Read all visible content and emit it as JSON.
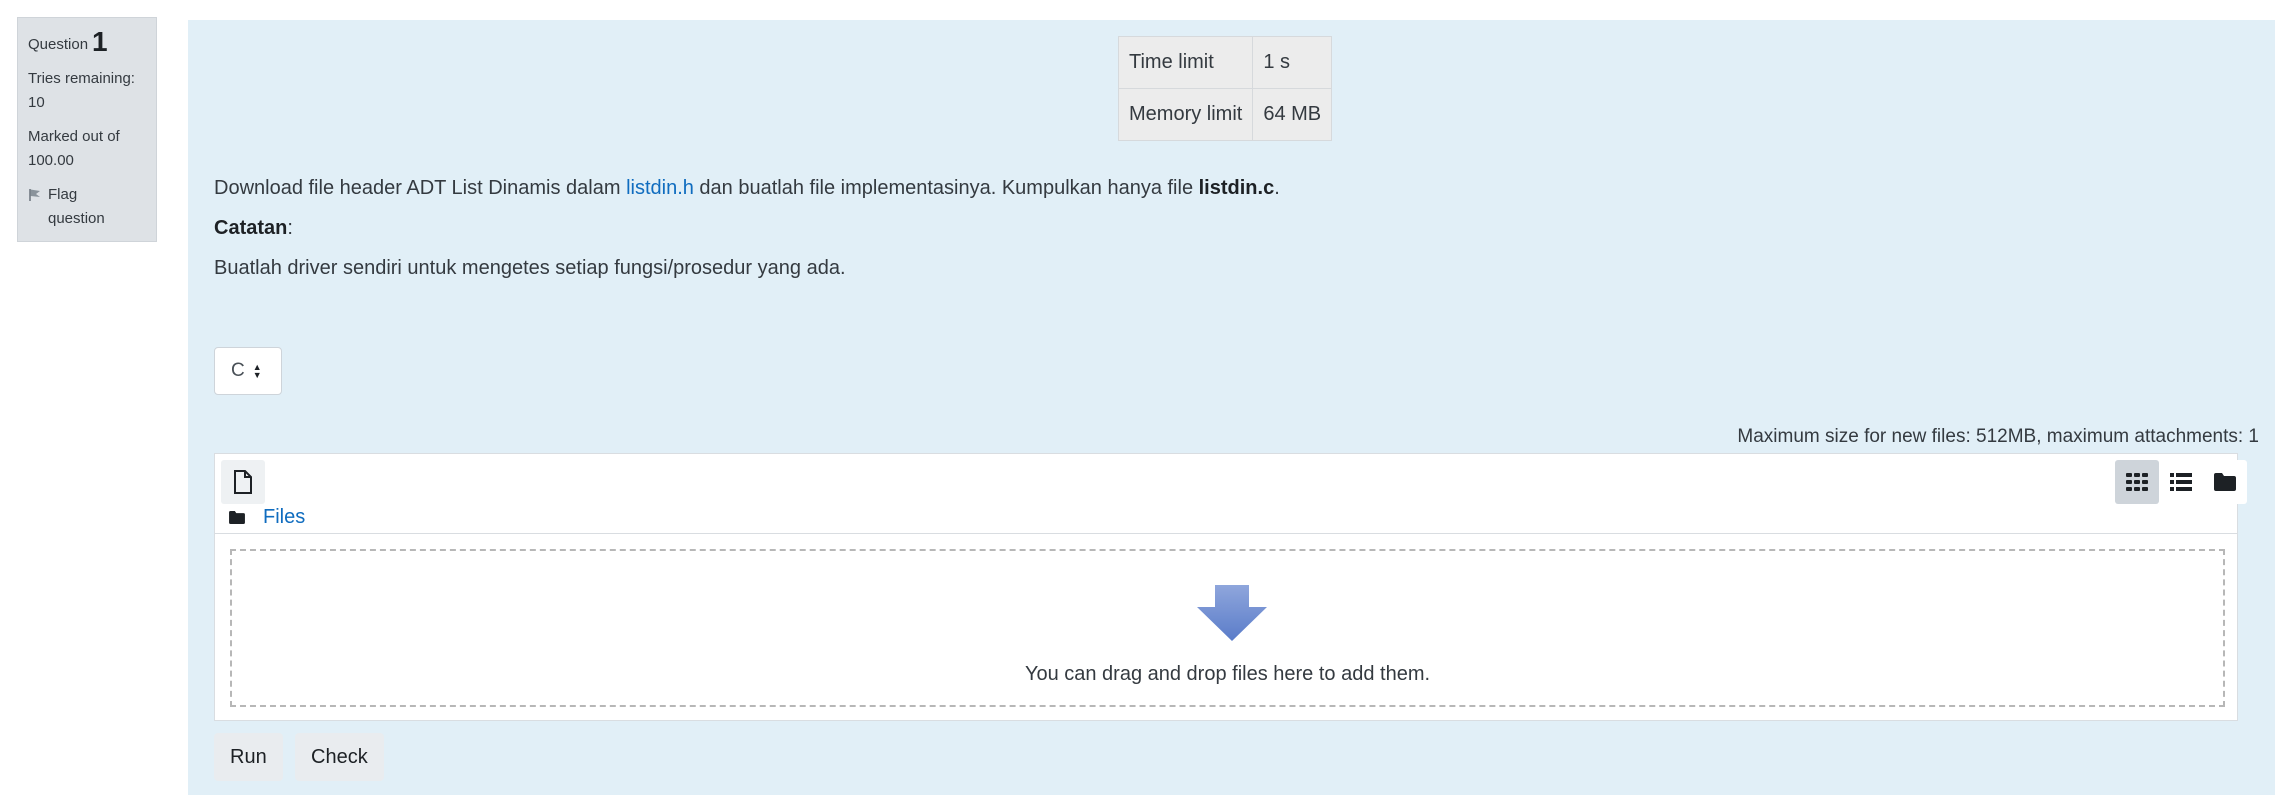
{
  "question_info": {
    "question_label": "Question",
    "question_number": "1",
    "tries_remaining": "Tries remaining:",
    "tries_count": "10",
    "marked_out_of": "Marked out of",
    "max_mark": "100.00",
    "flag_line1": "Flag",
    "flag_line2": "question"
  },
  "limits": [
    {
      "label": "Time limit",
      "value": "1 s"
    },
    {
      "label": "Memory limit",
      "value": "64 MB"
    }
  ],
  "description": {
    "line1_pre": "Download file header ADT List Dinamis dalam ",
    "line1_link": "listdin.h",
    "line1_mid": " dan buatlah file implementasinya. Kumpulkan hanya file ",
    "line1_bold": "listdin.c",
    "line1_end": ".",
    "note_label": "Catatan",
    "note_colon": ":",
    "line3": "Buatlah driver sendiri untuk mengetes setiap fungsi/prosedur yang ada."
  },
  "language_select": {
    "value": "C"
  },
  "filemanager": {
    "max_size_text": "Maximum size for new files: 512MB, maximum attachments: 1",
    "path_label": "Files",
    "drop_text": "You can drag and drop files here to add them.",
    "add_file_icon": "file-icon",
    "view_icons": [
      "grid-view-icon",
      "list-view-icon",
      "folder-view-icon"
    ]
  },
  "buttons": {
    "run": "Run",
    "check": "Check"
  },
  "colors": {
    "content_bg": "#e1eff7",
    "link": "#0f6cbf",
    "info_bg": "#dee2e6"
  }
}
